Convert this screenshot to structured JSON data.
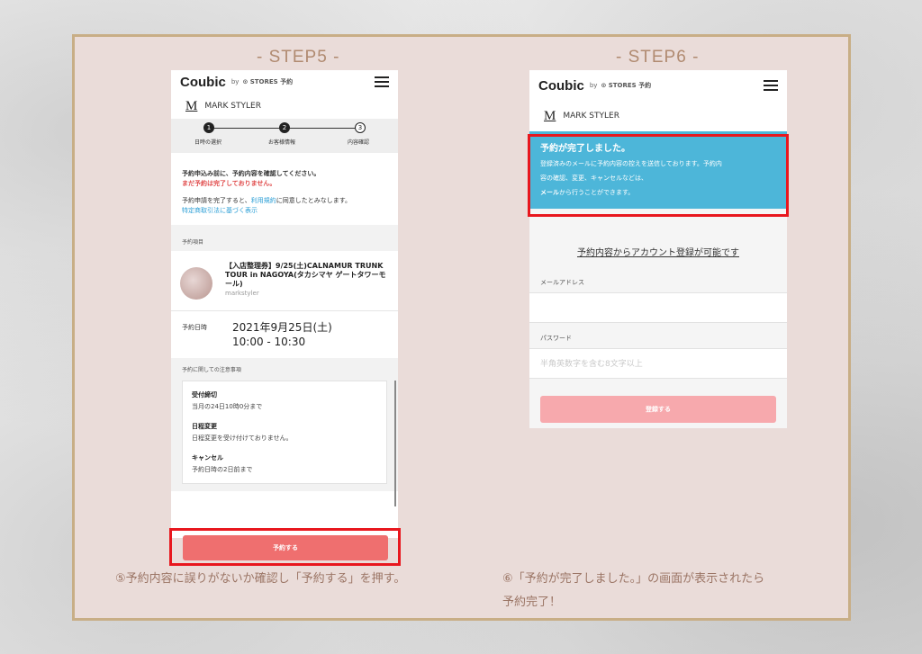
{
  "step5": {
    "title": "- STEP5 -",
    "header": {
      "logo": "Coubic",
      "by": "by",
      "stores": "⊙ STORES 予約"
    },
    "shop": {
      "mark": "M",
      "name": "MARK STYLER"
    },
    "progress": [
      "日時の選択",
      "お客様情報",
      "内容確認"
    ],
    "progress_nums": [
      "1",
      "2",
      "3"
    ],
    "notice": {
      "line1": "予約申込み前に、予約内容を確認してください。",
      "line2": "まだ予約は完了しておりません。",
      "line3_pre": "予約申請を完了すると、",
      "line3_link": "利用規約",
      "line3_post": "に同意したとみなします。",
      "line4": "特定商取引法に基づく表示"
    },
    "item_section": "予約項目",
    "item_title": "【入店整理券】9/25(土)CALNAMUR TRUNK TOUR in NAGOYA(タカシマヤ ゲートタワーモール)",
    "item_sub": "markstyler",
    "datetime_label": "予約日時",
    "datetime_date": "2021年9月25日(土)",
    "datetime_time": "10:00 - 10:30",
    "notes_section": "予約に関しての注意事項",
    "notes": [
      {
        "h": "受付締切",
        "b": "当月の24日10時0分まで"
      },
      {
        "h": "日程変更",
        "b": "日程変更を受け付けておりません。"
      },
      {
        "h": "キャンセル",
        "b": "予約日時の2日前まで"
      }
    ],
    "button": "予約する",
    "caption": "⑤予約内容に誤りがないか確認し「予約する」を押す。"
  },
  "step6": {
    "title": "- STEP6 -",
    "header": {
      "logo": "Coubic",
      "by": "by",
      "stores": "⊙ STORES 予約"
    },
    "shop": {
      "mark": "M",
      "name": "MARK STYLER"
    },
    "complete": {
      "heading": "予約が完了しました。",
      "line1": "登録済みのメールに予約内容の控えを送信しております。予約内",
      "line2": "容の確認、変更、キャンセルなどは、",
      "line3_bold": "メール",
      "line3_rest": "から行うことができます。"
    },
    "register_link": "予約内容からアカウント登録が可能です",
    "email_label": "メールアドレス",
    "password_label": "パスワード",
    "password_placeholder": "半角英数字を含む8文字以上",
    "button": "登録する",
    "caption_line1": "⑥「予約が完了しました。」の画面が表示されたら",
    "caption_line2": "予約完了！"
  },
  "colors": {
    "panel": "#eadcd9",
    "border": "#c8ae86",
    "title": "#b08a70",
    "reserve_button": "#ef6f6f",
    "register_button": "#f7a9ad",
    "complete_banner": "#4db6d9",
    "highlight": "#e8171e"
  }
}
